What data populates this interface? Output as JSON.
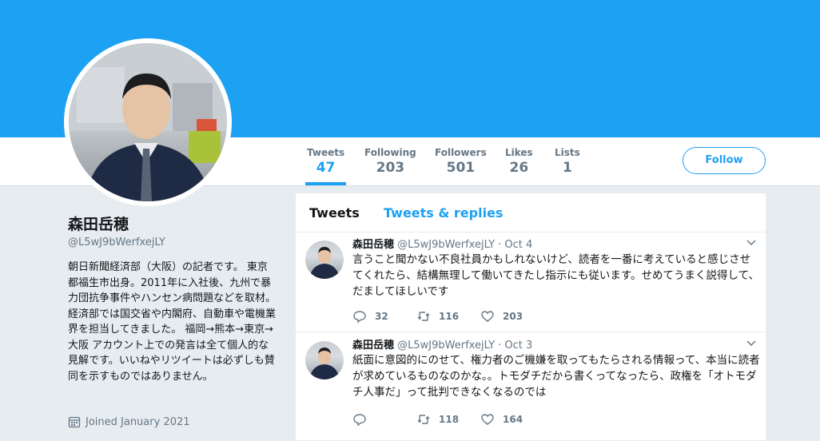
{
  "profile": {
    "name": "森田岳穂",
    "handle": "@L5wJ9bWerfxejLY",
    "bio": "朝日新聞経済部（大阪）の記者です。 東京都福生市出身。2011年に入社後、九州で暴力団抗争事件やハンセン病問題などを取材。経済部では国交省や内閣府、自動車や電機業界を担当してきました。 福岡→熊本→東京→大阪 アカウント上での発言は全て個人的な見解です。いいねやリツイートは必ずしも賛同を示すものではありません。",
    "joined": "Joined January 2021"
  },
  "stats": [
    {
      "label": "Tweets",
      "value": "47"
    },
    {
      "label": "Following",
      "value": "203"
    },
    {
      "label": "Followers",
      "value": "501"
    },
    {
      "label": "Likes",
      "value": "26"
    },
    {
      "label": "Lists",
      "value": "1"
    }
  ],
  "follow_label": "Follow",
  "tabs": {
    "tweets": "Tweets",
    "replies": "Tweets & replies"
  },
  "tweets": [
    {
      "name": "森田岳穂",
      "meta": "@L5wJ9bWerfxejLY · Oct 4",
      "text": "言うこと聞かない不良社員かもしれないけど、読者を一番に考えていると感じさせてくれたら、結構無理して働いてきたし指示にも従います。せめてうまく説得して、だましてほしいです",
      "replies": "32",
      "retweets": "116",
      "likes": "203"
    },
    {
      "name": "森田岳穂",
      "meta": "@L5wJ9bWerfxejLY · Oct 3",
      "text": "紙面に意図的にのせて、権力者のご機嫌を取ってもたらされる情報って、本当に読者が求めているものなのかな。。トモダチだから書くってなったら、政権を「オトモダチ人事だ」って批判できなくなるのでは",
      "replies": "",
      "retweets": "118",
      "likes": "164"
    }
  ],
  "colors": {
    "brand": "#1da1f2",
    "muted": "#657786",
    "bg": "#e6ecf0"
  }
}
